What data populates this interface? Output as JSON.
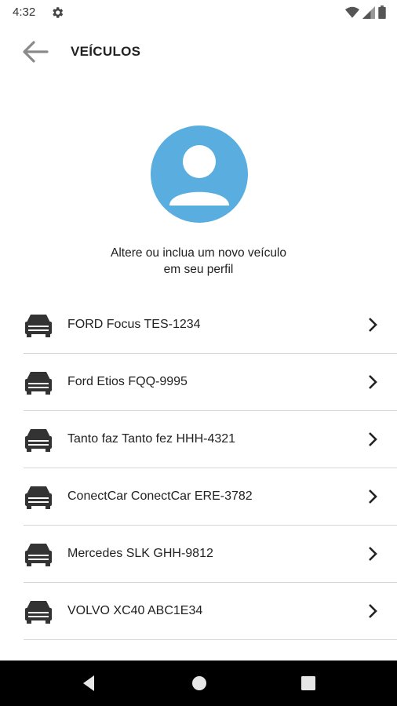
{
  "status": {
    "time": "4:32"
  },
  "header": {
    "title": "VEÍCULOS"
  },
  "profile": {
    "subtitle_line1": "Altere ou inclua um novo veículo",
    "subtitle_line2": "em seu perfil"
  },
  "vehicles": [
    {
      "label": "FORD Focus TES-1234"
    },
    {
      "label": "Ford Etios FQQ-9995"
    },
    {
      "label": "Tanto faz Tanto fez HHH-4321"
    },
    {
      "label": "ConectCar ConectCar ERE-3782"
    },
    {
      "label": "Mercedes SLK GHH-9812"
    },
    {
      "label": "VOLVO XC40 ABC1E34"
    }
  ],
  "colors": {
    "avatar_bg": "#5aaedf",
    "nav_bar": "#000000",
    "icon": "#333333"
  },
  "icons": [
    "gear-icon",
    "wifi-icon",
    "signal-icon",
    "battery-icon",
    "back-arrow-icon",
    "user-icon",
    "car-icon",
    "chevron-right-icon",
    "nav-back-icon",
    "nav-home-icon",
    "nav-recents-icon"
  ]
}
